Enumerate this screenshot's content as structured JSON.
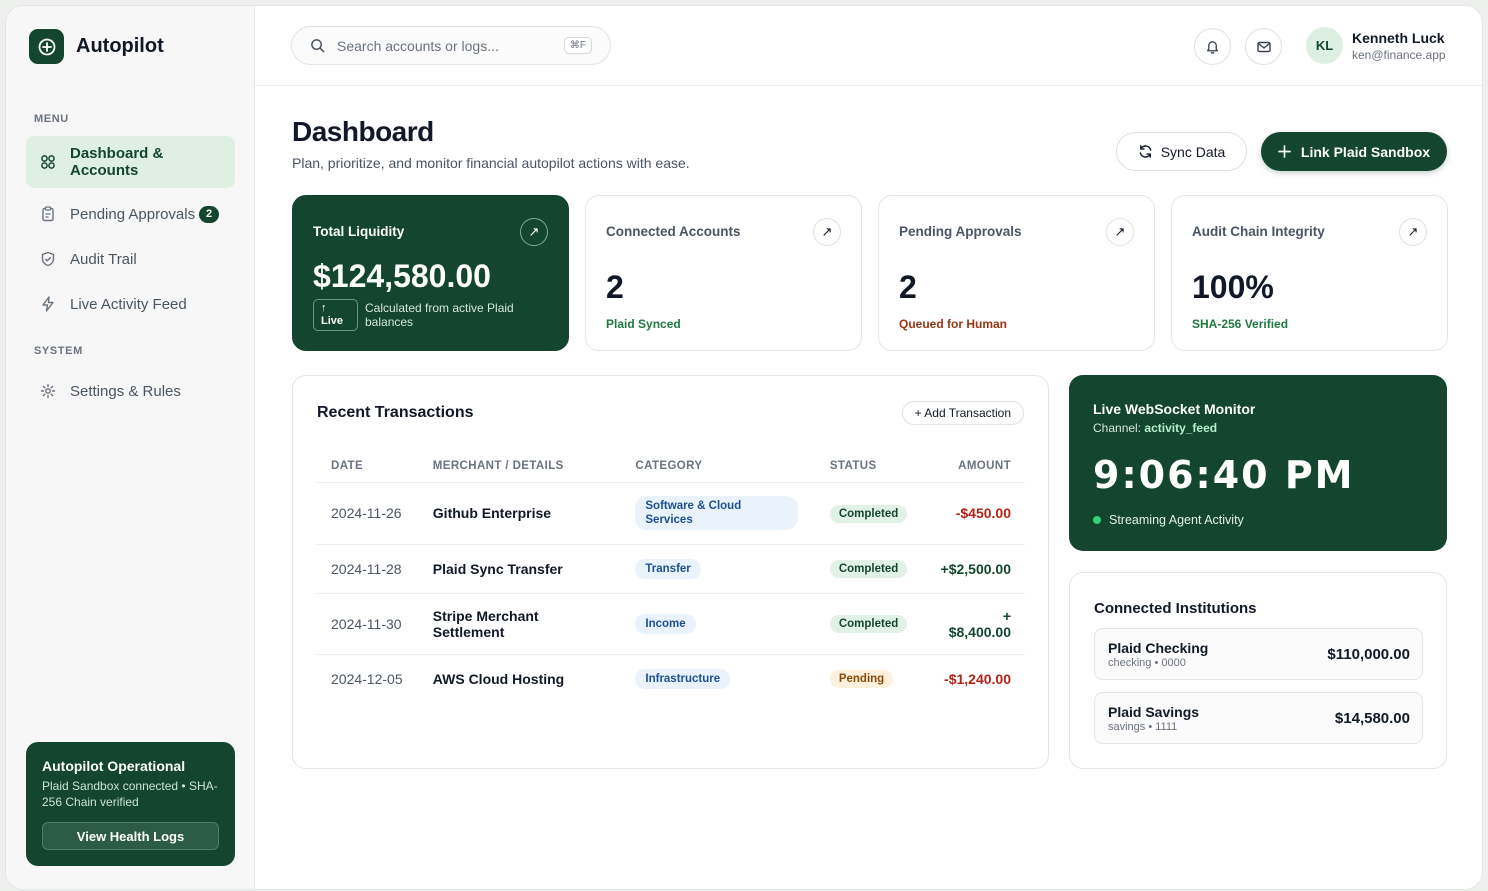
{
  "brand": {
    "name": "Autopilot",
    "color": "#14452f"
  },
  "sidebar": {
    "menu_label": "MENU",
    "system_label": "SYSTEM",
    "items": [
      {
        "label": "Dashboard & Accounts",
        "icon": "grid-icon",
        "active": true
      },
      {
        "label": "Pending Approvals",
        "icon": "clipboard-icon",
        "badge": "2"
      },
      {
        "label": "Audit Trail",
        "icon": "shield-check-icon"
      },
      {
        "label": "Live Activity Feed",
        "icon": "lightning-icon"
      }
    ],
    "system_items": [
      {
        "label": "Settings & Rules",
        "icon": "gear-icon"
      }
    ],
    "status": {
      "title": "Autopilot Operational",
      "subtitle": "Plaid Sandbox connected • SHA-256 Chain verified",
      "button": "View Health Logs"
    }
  },
  "search": {
    "placeholder": "Search accounts or logs...",
    "shortcut": "⌘F"
  },
  "user": {
    "initials": "KL",
    "name": "Kenneth Luck",
    "email": "ken@finance.app"
  },
  "header": {
    "title": "Dashboard",
    "subtitle": "Plan, prioritize, and monitor financial autopilot actions with ease.",
    "sync_label": "Sync Data",
    "link_label": "Link Plaid Sandbox"
  },
  "stats": [
    {
      "label": "Total Liquidity",
      "value": "$124,580.00",
      "chip": "Live",
      "note": "Calculated from active Plaid balances"
    },
    {
      "label": "Connected Accounts",
      "value": "2",
      "foot": "Plaid Synced",
      "foot_color": "#1f7a3f"
    },
    {
      "label": "Pending Approvals",
      "value": "2",
      "foot": "Queued for Human",
      "foot_color": "#9a3412"
    },
    {
      "label": "Audit Chain Integrity",
      "value": "100%",
      "foot": "SHA-256 Verified",
      "foot_color": "#1f7a3f"
    }
  ],
  "transactions": {
    "title": "Recent Transactions",
    "add_label": "+ Add Transaction",
    "columns": [
      "DATE",
      "MERCHANT / DETAILS",
      "CATEGORY",
      "STATUS",
      "AMOUNT"
    ],
    "rows": [
      {
        "date": "2024-11-26",
        "merchant": "Github Enterprise",
        "category": "Software & Cloud Services",
        "status": "Completed",
        "amount": "-$450.00"
      },
      {
        "date": "2024-11-28",
        "merchant": "Plaid Sync Transfer",
        "category": "Transfer",
        "status": "Completed",
        "amount": "+$2,500.00"
      },
      {
        "date": "2024-11-30",
        "merchant": "Stripe Merchant Settlement",
        "category": "Income",
        "status": "Completed",
        "amount": "+ $8,400.00"
      },
      {
        "date": "2024-12-05",
        "merchant": "AWS Cloud Hosting",
        "category": "Infrastructure",
        "status": "Pending",
        "amount": "-$1,240.00"
      }
    ]
  },
  "monitor": {
    "title": "Live WebSocket Monitor",
    "channel_label": "Channel:",
    "channel": "activity_feed",
    "clock": "9:06:40 PM",
    "stream": "Streaming Agent Activity"
  },
  "institutions": {
    "title": "Connected Institutions",
    "items": [
      {
        "name": "Plaid Checking",
        "meta": "checking • 0000",
        "balance": "$110,000.00"
      },
      {
        "name": "Plaid Savings",
        "meta": "savings • 1111",
        "balance": "$14,580.00"
      }
    ]
  }
}
